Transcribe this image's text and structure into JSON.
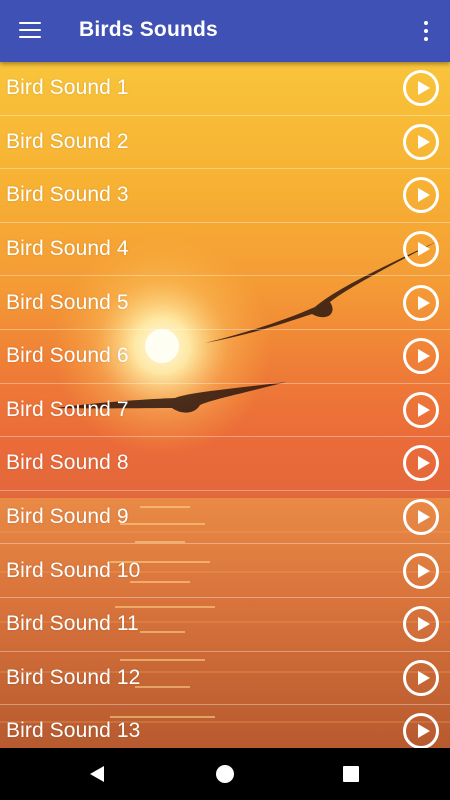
{
  "appbar": {
    "menu_icon": "hamburger-menu-icon",
    "title": "Birds Sounds",
    "overflow_icon": "more-vert-icon",
    "color": "#3f51b5"
  },
  "list": {
    "items": [
      {
        "label": "Bird Sound 1"
      },
      {
        "label": "Bird Sound 2"
      },
      {
        "label": "Bird Sound 3"
      },
      {
        "label": "Bird Sound 4"
      },
      {
        "label": "Bird Sound 5"
      },
      {
        "label": "Bird Sound 6"
      },
      {
        "label": "Bird Sound 7"
      },
      {
        "label": "Bird Sound 8"
      },
      {
        "label": "Bird Sound 9"
      },
      {
        "label": "Bird Sound 10"
      },
      {
        "label": "Bird Sound 11"
      },
      {
        "label": "Bird Sound 12"
      },
      {
        "label": "Bird Sound 13"
      }
    ],
    "play_icon": "play-circle-icon",
    "background": "sunset-sea-with-birds"
  },
  "navbar": {
    "back_icon": "back-triangle-icon",
    "home_icon": "home-circle-icon",
    "recents_icon": "recents-square-icon"
  }
}
